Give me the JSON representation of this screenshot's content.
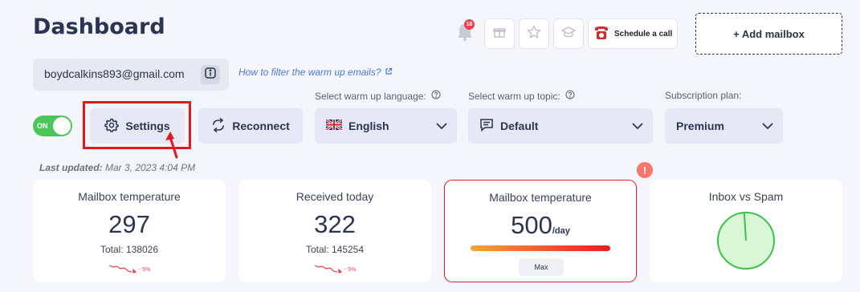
{
  "header": {
    "title": "Dashboard",
    "notification_count": "18",
    "schedule_label": "Schedule a call",
    "add_mailbox_label": "+ Add mailbox"
  },
  "account": {
    "email": "boydcalkins893@gmail.com",
    "help_link": "How to filter the warm up emails?"
  },
  "controls": {
    "toggle_label": "ON",
    "toggle_on": true,
    "settings_label": "Settings",
    "reconnect_label": "Reconnect",
    "language_label": "Select warm up language:",
    "language_value": "English",
    "topic_label": "Select warm up topic:",
    "topic_value": "Default",
    "plan_label": "Subscription plan:",
    "plan_value": "Premium"
  },
  "last_updated": {
    "label": "Last updated:",
    "value": "Mar 3, 2023 4:04 PM"
  },
  "cards": [
    {
      "title": "Mailbox temperature",
      "value": "297",
      "total": "Total: 138026",
      "trend": "- 5%"
    },
    {
      "title": "Received today",
      "value": "322",
      "total": "Total: 145254",
      "trend": "- 5%"
    },
    {
      "title": "Mailbox temperature",
      "value": "500",
      "unit": "/day",
      "button": "Max",
      "warning": "!"
    },
    {
      "title": "Inbox vs Spam",
      "inbox_fraction": 0.99
    }
  ],
  "colors": {
    "accent": "#2b3553",
    "toggle": "#4cc65a",
    "highlight": "#e0191f",
    "link": "#4c79d8",
    "danger": "#ec3f50",
    "pie": "#3cc34b"
  },
  "icons": [
    "bell-icon",
    "gift-icon",
    "star-icon",
    "graduation-cap-icon",
    "telephone-icon",
    "info-icon",
    "external-link-icon",
    "help-circle-icon",
    "gear-icon",
    "refresh-icon",
    "uk-flag-icon",
    "message-icon",
    "chevron-down-icon",
    "trend-down-icon",
    "warning-icon"
  ]
}
